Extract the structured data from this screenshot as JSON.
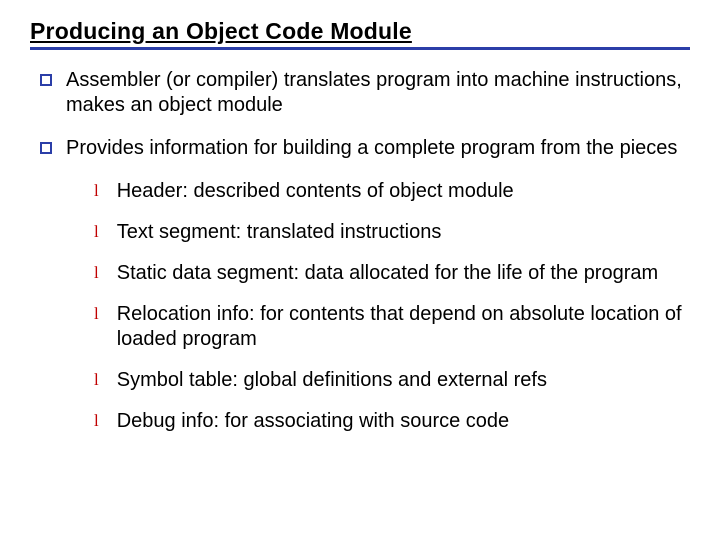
{
  "title": "Producing an Object Code Module",
  "bullets": [
    {
      "text": "Assembler (or compiler) translates program into machine instructions, makes an object module"
    },
    {
      "text": "Provides information for building a complete program from the pieces"
    }
  ],
  "sub_bullets": [
    {
      "text": "Header: described contents of object module"
    },
    {
      "text": "Text segment: translated instructions"
    },
    {
      "text": "Static data segment: data allocated for the life of the program"
    },
    {
      "text": "Relocation info: for contents that depend on absolute location of loaded program"
    },
    {
      "text": "Symbol table: global definitions and external refs"
    },
    {
      "text": "Debug info: for associating with source code"
    }
  ],
  "colors": {
    "rule": "#2b3ea8",
    "sub_marker": "#c00000"
  }
}
